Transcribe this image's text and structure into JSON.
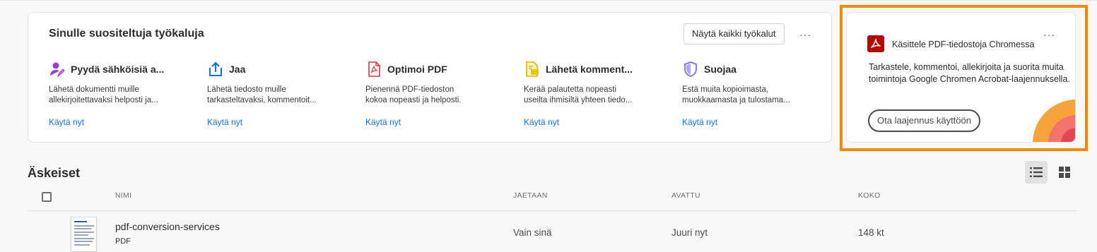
{
  "tools": {
    "title": "Sinulle suositeltuja työkaluja",
    "show_all_label": "Näytä kaikki työkalut",
    "more_label": "···",
    "items": [
      {
        "name": "Pyydä sähköisiä a...",
        "description": "Lähetä dokumentti muille\nallekirjoitettavaksi helposti ja...",
        "action": "Käytä nyt",
        "icon": "signature-request-icon",
        "color": "#9b3fc7"
      },
      {
        "name": "Jaa",
        "description": "Lähetä tiedosto muille\ntarkasteltavaksi, kommentoit...",
        "action": "Käytä nyt",
        "icon": "share-icon",
        "color": "#1473e6"
      },
      {
        "name": "Optimoi PDF",
        "description": "Pienennä PDF-tiedoston\nkokoa nopeasti ja helposti.",
        "action": "Käytä nyt",
        "icon": "optimize-pdf-icon",
        "color": "#d7373f"
      },
      {
        "name": "Lähetä komment...",
        "description": "Kerää palautetta nopeasti\nuseilta ihmisiltä yhteen tiedo...",
        "action": "Käytä nyt",
        "icon": "send-comments-icon",
        "color": "#e8c600"
      },
      {
        "name": "Suojaa",
        "description": "Estä muita kopioimasta,\nmuokkaamasta ja tulostama...",
        "action": "Käytä nyt",
        "icon": "protect-shield-icon",
        "color": "#7a6fd0"
      }
    ]
  },
  "promo": {
    "title": "Käsittele PDF-tiedostoja Chromessa",
    "description": "Tarkastele, kommentoi, allekirjoita ja suorita muita toimintoja Google Chromen Acrobat-laajennuksella.",
    "button_label": "Ota laajennus käyttöön",
    "more_label": "···",
    "icon": "acrobat-logo-icon",
    "accent_colors": [
      "#f6a33b",
      "#f4736b",
      "#e34850"
    ],
    "highlight_color": "#f08a00"
  },
  "recent": {
    "title": "Äskeiset",
    "columns": {
      "name": "NIMI",
      "shared": "JAETAAN",
      "opened": "AVATTU",
      "size": "KOKO"
    },
    "files": [
      {
        "name": "pdf-conversion-services",
        "type": "PDF",
        "shared": "Vain sinä",
        "opened": "Juuri nyt",
        "size": "148 kt"
      }
    ]
  }
}
